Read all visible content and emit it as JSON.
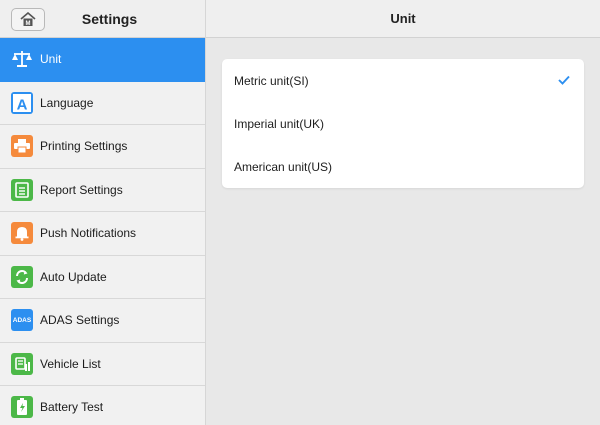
{
  "sidebar": {
    "title": "Settings",
    "home_icon": "home-icon",
    "items": [
      {
        "label": "Unit",
        "icon": "scale-icon",
        "active": true
      },
      {
        "label": "Language",
        "icon": "language-icon"
      },
      {
        "label": "Printing Settings",
        "icon": "printer-icon"
      },
      {
        "label": "Report Settings",
        "icon": "report-icon"
      },
      {
        "label": "Push Notifications",
        "icon": "bell-icon"
      },
      {
        "label": "Auto Update",
        "icon": "refresh-icon"
      },
      {
        "label": "ADAS Settings",
        "icon": "adas-icon",
        "icon_text": "ADAS"
      },
      {
        "label": "Vehicle List",
        "icon": "vehicle-list-icon"
      },
      {
        "label": "Battery Test",
        "icon": "battery-icon"
      }
    ]
  },
  "header": {
    "title": "Unit"
  },
  "unit_options": [
    {
      "label": "Metric unit(SI)",
      "selected": true
    },
    {
      "label": "Imperial unit(UK)",
      "selected": false
    },
    {
      "label": "American unit(US)",
      "selected": false
    }
  ],
  "colors": {
    "accent": "#2c8ff0",
    "orange": "#f58a3c",
    "green": "#4cb848",
    "blue": "#2c8ff0"
  }
}
